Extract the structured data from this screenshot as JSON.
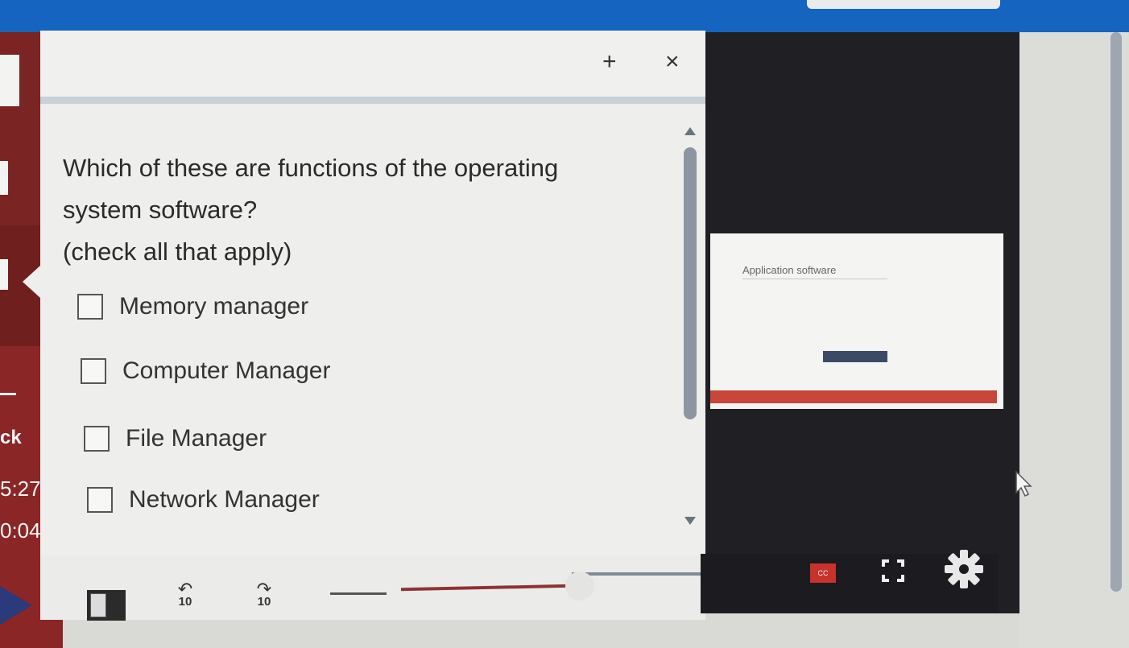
{
  "panel": {
    "add_icon": "+",
    "close_icon": "×"
  },
  "question": {
    "line1": "Which of these are functions of the operating",
    "line2": "system software?",
    "line3": "(check all that apply)"
  },
  "options": [
    {
      "label": "Memory manager",
      "checked": false
    },
    {
      "label": "Computer Manager",
      "checked": false
    },
    {
      "label": "File Manager",
      "checked": false
    },
    {
      "label": "Network Manager",
      "checked": false
    }
  ],
  "sidebar": {
    "partial_label": "ck",
    "time_total": "5:27",
    "time_current": "0:04"
  },
  "player": {
    "rewind_label": "10",
    "forward_label": "10",
    "cc_label": "CC",
    "seek_progress": 0.47,
    "icons": [
      "notes-icon",
      "rewind-10-icon",
      "forward-10-icon",
      "cc-icon",
      "fullscreen-icon",
      "gear-icon"
    ]
  },
  "video": {
    "slide_title": "Application software"
  },
  "colors": {
    "top_bar": "#1565c0",
    "rail": "#8b2626",
    "cc_red": "#c8322a",
    "slide_red": "#c8473b"
  }
}
